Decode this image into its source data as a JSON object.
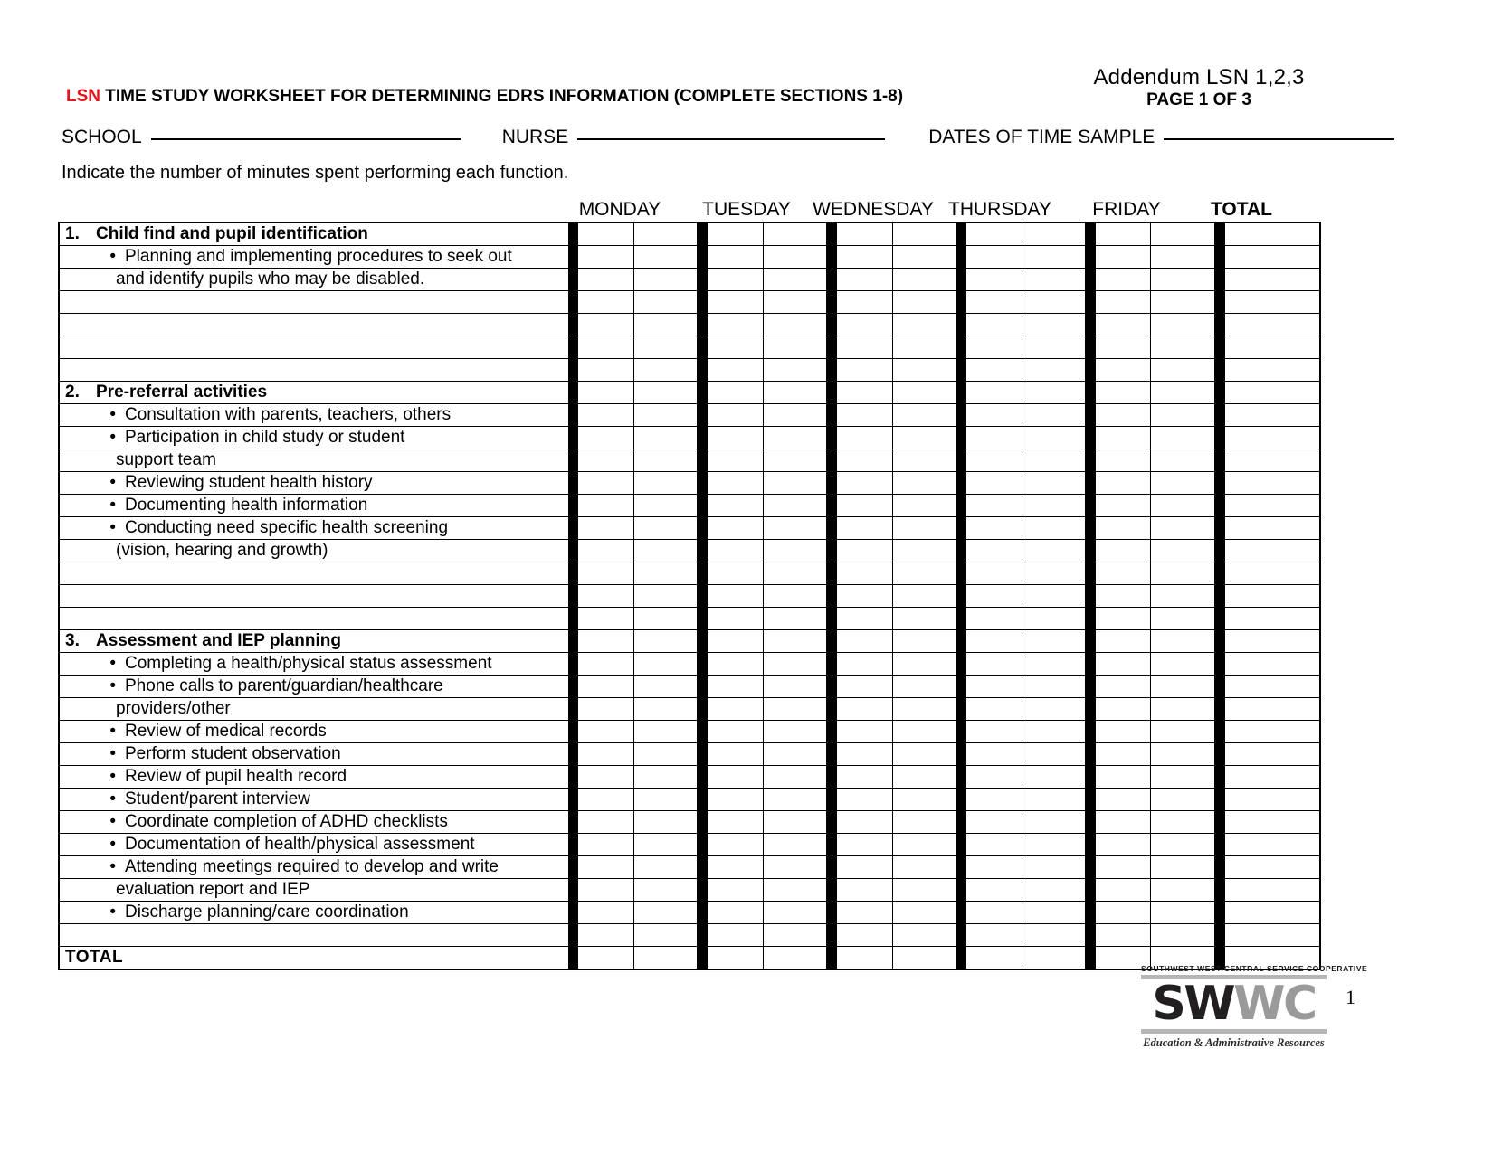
{
  "header": {
    "addendum": "Addendum LSN 1,2,3",
    "page_of": "PAGE 1 OF 3",
    "title_prefix": "LSN",
    "title_rest": " TIME STUDY WORKSHEET FOR DETERMINING EDRS INFORMATION (COMPLETE SECTIONS 1-8)",
    "accent_color": "#e8121a",
    "fields": {
      "school_label": "SCHOOL",
      "nurse_label": "NURSE",
      "dates_label": "DATES OF TIME SAMPLE",
      "school_value": "",
      "nurse_value": "",
      "dates_value": ""
    },
    "instruction": "Indicate the number of minutes spent performing each function."
  },
  "columns": {
    "days": [
      "MONDAY",
      "TUESDAY",
      "WEDNESDAY",
      "THURSDAY",
      "FRIDAY"
    ],
    "total": "TOTAL"
  },
  "rows": [
    {
      "type": "section",
      "num": "1.",
      "text": "Child find and pupil identification"
    },
    {
      "type": "bullet",
      "text": "Planning and implementing procedures to seek out"
    },
    {
      "type": "cont",
      "text": "and identify pupils who may be disabled."
    },
    {
      "type": "blank",
      "text": ""
    },
    {
      "type": "blank",
      "text": ""
    },
    {
      "type": "blank",
      "text": ""
    },
    {
      "type": "blank",
      "text": ""
    },
    {
      "type": "section",
      "num": "2.",
      "text": "Pre-referral activities"
    },
    {
      "type": "bullet",
      "text": "Consultation with parents, teachers, others"
    },
    {
      "type": "bullet",
      "text": "Participation in child study or student"
    },
    {
      "type": "cont",
      "text": "support team"
    },
    {
      "type": "bullet",
      "text": "Reviewing student health history"
    },
    {
      "type": "bullet",
      "text": "Documenting health information"
    },
    {
      "type": "bullet",
      "text": "Conducting need specific health screening"
    },
    {
      "type": "cont",
      "text": "(vision, hearing and growth)"
    },
    {
      "type": "blank",
      "text": ""
    },
    {
      "type": "blank",
      "text": ""
    },
    {
      "type": "blank",
      "text": ""
    },
    {
      "type": "section",
      "num": "3.",
      "text": "Assessment and IEP planning"
    },
    {
      "type": "bullet",
      "text": "Completing a health/physical status assessment"
    },
    {
      "type": "bullet",
      "text": "Phone calls to parent/guardian/healthcare"
    },
    {
      "type": "cont",
      "text": "providers/other"
    },
    {
      "type": "bullet",
      "text": "Review of medical records"
    },
    {
      "type": "bullet",
      "text": "Perform student observation"
    },
    {
      "type": "bullet",
      "text": "Review of pupil health record"
    },
    {
      "type": "bullet",
      "text": "Student/parent interview"
    },
    {
      "type": "bullet",
      "text": "Coordinate completion of ADHD checklists"
    },
    {
      "type": "bullet",
      "text": "Documentation of health/physical assessment"
    },
    {
      "type": "bullet",
      "text": "Attending meetings required to develop and write"
    },
    {
      "type": "cont",
      "text": "evaluation report and IEP"
    },
    {
      "type": "bullet",
      "text": "Discharge planning/care coordination"
    },
    {
      "type": "blank",
      "text": ""
    },
    {
      "type": "total",
      "text": "TOTAL"
    }
  ],
  "footer": {
    "logo_top": "SOUTHWEST WEST CENTRAL SERVICE COOPERATIVE",
    "logo_word_dark": "SW",
    "logo_word_light": "WC",
    "logo_sub": "Education & Administrative Resources",
    "page_number": "1"
  }
}
